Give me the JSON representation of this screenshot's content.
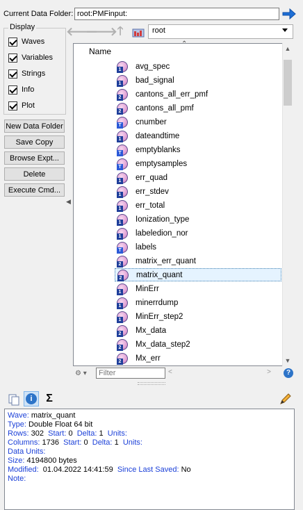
{
  "header": {
    "current_folder_label": "Current Data Folder:",
    "current_folder_value": "root:PMFinput:"
  },
  "display": {
    "title": "Display",
    "checkboxes": [
      {
        "label": "Waves",
        "checked": true
      },
      {
        "label": "Variables",
        "checked": true
      },
      {
        "label": "Strings",
        "checked": true
      },
      {
        "label": "Info",
        "checked": true
      },
      {
        "label": "Plot",
        "checked": true
      }
    ]
  },
  "buttons": {
    "new_folder": "New Data Folder",
    "save_copy": "Save Copy",
    "browse_expt": "Browse Expt...",
    "delete": "Delete",
    "execute_cmd": "Execute Cmd..."
  },
  "browser": {
    "folder_select": "root",
    "column_header": "Name",
    "items": [
      {
        "name": "avg_spec",
        "badge": "1"
      },
      {
        "name": "bad_signal",
        "badge": "1"
      },
      {
        "name": "cantons_all_err_pmf",
        "badge": "2"
      },
      {
        "name": "cantons_all_pmf",
        "badge": "2"
      },
      {
        "name": "cnumber",
        "badge": "T"
      },
      {
        "name": "dateandtime",
        "badge": "1"
      },
      {
        "name": "emptyblanks",
        "badge": "T"
      },
      {
        "name": "emptysamples",
        "badge": "T"
      },
      {
        "name": "err_quad",
        "badge": "1"
      },
      {
        "name": "err_stdev",
        "badge": "1"
      },
      {
        "name": "err_total",
        "badge": "1"
      },
      {
        "name": "Ionization_type",
        "badge": "1"
      },
      {
        "name": "labeledion_nor",
        "badge": "1"
      },
      {
        "name": "labels",
        "badge": "T"
      },
      {
        "name": "matrix_err_quant",
        "badge": "2"
      },
      {
        "name": "matrix_quant",
        "badge": "2",
        "selected": true
      },
      {
        "name": "MinErr",
        "badge": "1"
      },
      {
        "name": "minerrdump",
        "badge": "1"
      },
      {
        "name": "MinErr_step2",
        "badge": "1"
      },
      {
        "name": "Mx_data",
        "badge": "2"
      },
      {
        "name": "Mx_data_step2",
        "badge": "2"
      },
      {
        "name": "Mx_err",
        "badge": "2"
      }
    ],
    "filter_placeholder": "Filter",
    "help": "?"
  },
  "info": {
    "wave_label": "Wave:",
    "wave_value": "matrix_quant",
    "type_label": "Type:",
    "type_value": "Double Float 64 bit",
    "rows_label": "Rows:",
    "rows_value": "302",
    "rows_start_label": "Start:",
    "rows_start": "0",
    "rows_delta_label": "Delta:",
    "rows_delta": "1",
    "rows_units_label": "Units:",
    "cols_label": "Columns:",
    "cols_value": "1736",
    "cols_start_label": "Start:",
    "cols_start": "0",
    "cols_delta_label": "Delta:",
    "cols_delta": "1",
    "cols_units_label": "Units:",
    "dataunits_label": "Data Units:",
    "size_label": "Size:",
    "size_value": "4194800 bytes",
    "modified_label": "Modified:",
    "modified_value": "01.04.2022 14:41:59",
    "saved_label": "Since Last Saved:",
    "saved_value": "No",
    "note_label": "Note:"
  }
}
